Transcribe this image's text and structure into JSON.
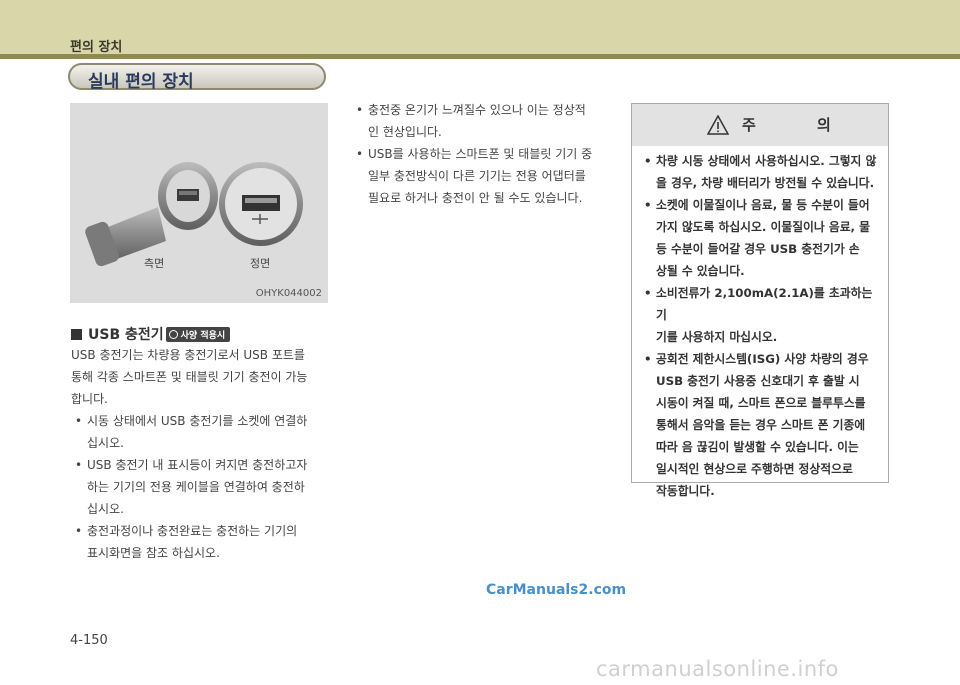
{
  "header": {
    "title": "편의 장치"
  },
  "section": {
    "title": "실내 편의 장치"
  },
  "figure": {
    "label_side": "측면",
    "label_front": "정면",
    "code": "OHYK044002"
  },
  "usb": {
    "heading": "USB 충전기",
    "badge": "사양 적용시",
    "intro_lines": [
      "USB 충전기는 차량용 충전기로서 USB 포트를",
      "통해 각종 스마트폰 및 태블릿 기기 충전이 가능",
      "합니다."
    ],
    "bullets": [
      [
        "시동 상태에서 USB 충전기를 소켓에 연결하",
        "십시오."
      ],
      [
        "USB 충전기 내 표시등이 켜지면 충전하고자",
        "하는 기기의 전용 케이블을 연결하여 충전하",
        "십시오."
      ],
      [
        "충전과정이나 충전완료는 충전하는 기기의",
        "표시화면을 참조 하십시오."
      ]
    ]
  },
  "middle": {
    "bullets": [
      [
        "충전중 온기가 느껴질수 있으나 이는 정상적",
        "인 현상입니다."
      ],
      [
        "USB를 사용하는 스마트폰 및 태블릿 기기 중",
        "일부 충전방식이 다른 기기는 전용 어댑터를",
        "필요로 하거나 충전이 안 될 수도 있습니다."
      ]
    ]
  },
  "caution": {
    "title": "주 의",
    "bullets": [
      [
        "차량 시동 상태에서 사용하십시오. 그렇지 않",
        "을 경우, 차량 배터리가 방전될 수 있습니다."
      ],
      [
        "소켓에 이물질이나 음료, 물 등 수분이 들어",
        "가지 않도록 하십시오. 이물질이나 음료, 물",
        "등 수분이 들어갈 경우 USB 충전기가 손",
        "상될 수 있습니다."
      ],
      [
        "소비전류가 2,100mA(2.1A)를 초과하는 기",
        "기를 사용하지 마십시오."
      ],
      [
        "공회전 제한시스템(ISG) 사양 차량의 경우",
        "USB 충전기 사용중 신호대기 후 출발 시",
        "시동이 켜질 때, 스마트 폰으로 블루투스를",
        "통해서 음악을 듣는 경우 스마트 폰 기종에",
        "따라 음 끊김이 발생할 수 있습니다. 이는",
        "일시적인 현상으로 주행하면 정상적으로",
        "작동합니다."
      ]
    ]
  },
  "footer": {
    "page_number": "4-150",
    "watermark": "CarManuals2.com",
    "footer_watermark": "carmanualsonline.info"
  }
}
